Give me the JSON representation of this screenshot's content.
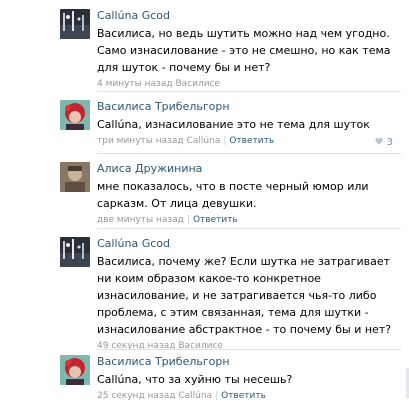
{
  "comments": [
    {
      "author": "Callúna Gcod",
      "avatar_icon": "dark-night-photo-avatar",
      "text": "Василиса, но ведь шутить можно над чем угодно. Само изнасилование - это не смешно, но как тема для шуток - почему бы и нет?",
      "time": "4 минуты назад",
      "reply_to": "Василисе"
    },
    {
      "author": "Василиса Трибельгорн",
      "avatar_icon": "red-hair-girl-avatar",
      "text": "Callúna, изнасилование это не тема для шуток",
      "time": "три минуты назад",
      "reply_to": "Callúna",
      "reply_label": "Ответить",
      "likes": "3"
    },
    {
      "author": "Алиса Дружинина",
      "avatar_icon": "sepia-portrait-avatar",
      "text": "мне показалось, что в посте черный юмор или сарказм. От лица девушки.",
      "time": "две минуты назад",
      "reply_label": "Ответить"
    },
    {
      "author": "Callúna Gcod",
      "avatar_icon": "dark-night-photo-avatar",
      "text": "Василиса, почему же? Если шутка не затрагивает ни коим образом какое-то конкретное изнасилование, и не затрагивается чья-то либо проблема, с этим связанная, тема для шутки - изнасилование абстрактное - то почему бы и нет?",
      "time": "49 секунд назад",
      "reply_to": "Василисе"
    },
    {
      "author": "Василиса Трибельгорн",
      "avatar_icon": "red-hair-girl-avatar",
      "text": "Callúna, что за хуйню ты несешь?",
      "time": "25 секунд назад",
      "reply_to": "Callúna",
      "reply_label": "Ответить"
    }
  ],
  "colors": {
    "link": "#2b587a",
    "meta": "#999999",
    "divider": "#dae1e8",
    "like": "#7a94ae"
  }
}
